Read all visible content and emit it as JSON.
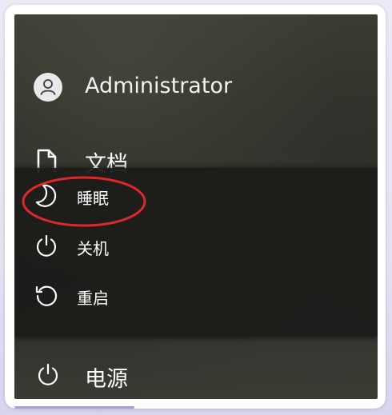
{
  "user": {
    "name": "Administrator",
    "icon": "user-avatar-icon"
  },
  "documents": {
    "label": "文档",
    "icon": "document-icon"
  },
  "power_menu": {
    "items": [
      {
        "label": "睡眠",
        "icon": "moon-icon",
        "highlighted": true
      },
      {
        "label": "关机",
        "icon": "power-icon",
        "highlighted": false
      },
      {
        "label": "重启",
        "icon": "restart-icon",
        "highlighted": false
      }
    ]
  },
  "power": {
    "label": "电源",
    "icon": "power-icon"
  },
  "colors": {
    "highlight_ring": "#e0262a",
    "text": "#ffffff",
    "flyout_background": "#1c1d1a",
    "frame_background": "#ece8f6"
  }
}
